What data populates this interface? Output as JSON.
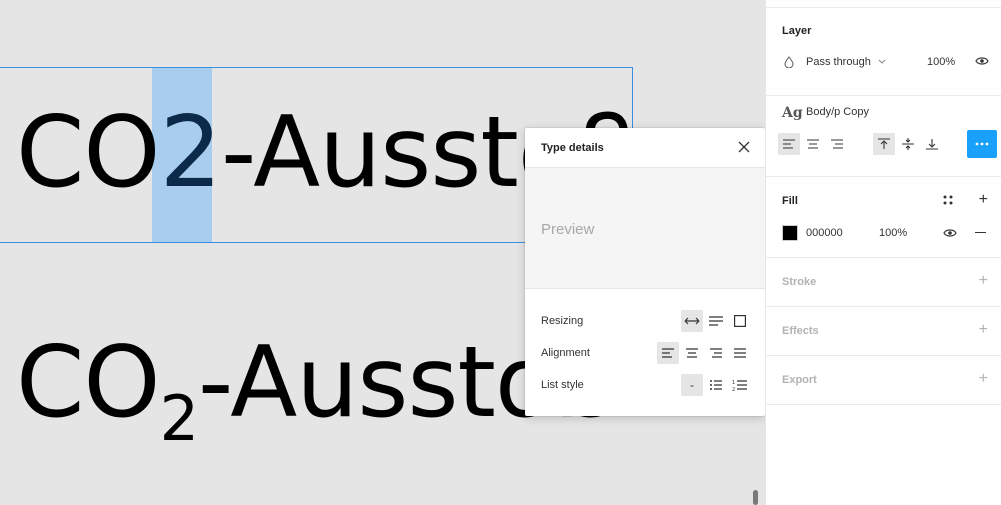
{
  "canvas": {
    "text_top": {
      "main": "CO",
      "selected": "2",
      "rest": "-Ausstoß"
    },
    "text_bottom": {
      "main": "CO",
      "subscript": "2",
      "rest": "-Ausstoß"
    }
  },
  "popup": {
    "title": "Type details",
    "preview_label": "Preview",
    "rows": {
      "resizing": "Resizing",
      "alignment": "Alignment",
      "list_style": "List style"
    },
    "list_dash": "-"
  },
  "panel": {
    "layer": {
      "title": "Layer",
      "blend_mode": "Pass through",
      "opacity": "100%"
    },
    "text_style": {
      "label": "Body/p Copy",
      "icon_glyph": "Ag"
    },
    "fill": {
      "title": "Fill",
      "hex": "000000",
      "opacity": "100%",
      "swatch_color": "#000000"
    },
    "stroke": {
      "title": "Stroke"
    },
    "effects": {
      "title": "Effects"
    },
    "export": {
      "title": "Export"
    }
  },
  "colors": {
    "accent": "#18a0fb",
    "selection": "#a9cdee",
    "frame": "#3b8fe0"
  }
}
